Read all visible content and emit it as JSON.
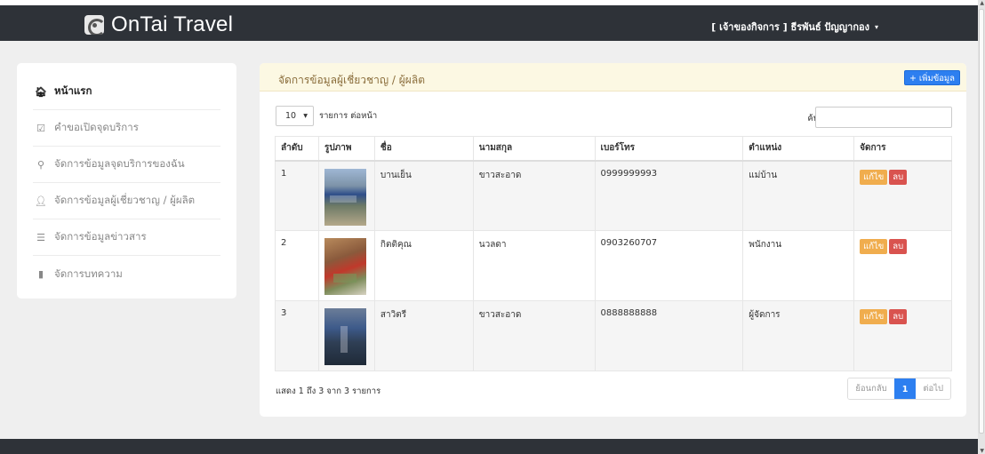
{
  "brand": {
    "name": "OnTai Travel"
  },
  "header": {
    "user": "[ เจ้าของกิจการ ] ธีรพันธ์ ปัญญากอง",
    "caret": "▾"
  },
  "sidebar": {
    "items": [
      {
        "label": "หน้าแรก",
        "icon": "home-icon",
        "glyph": "🏠︎",
        "active": true
      },
      {
        "label": "คำขอเปิดจุดบริการ",
        "icon": "check-square-icon",
        "glyph": "☑"
      },
      {
        "label": "จัดการข้อมูลจุดบริการของฉัน",
        "icon": "map-marker-icon",
        "glyph": "⚲"
      },
      {
        "label": "จัดการข้อมูลผู้เชี่ยวชาญ / ผู้ผลิต",
        "icon": "user-icon",
        "glyph": "👤︎"
      },
      {
        "label": "จัดการข้อมูลข่าวสาร",
        "icon": "list-icon",
        "glyph": "☰"
      },
      {
        "label": "จัดการบทความ",
        "icon": "book-icon",
        "glyph": "▮"
      }
    ]
  },
  "panel": {
    "title": "จัดการข้อมูลผู้เชี่ยวชาญ / ผู้ผลิต",
    "add_label": "+ เพิ่มข้อมูล",
    "page_size": "10",
    "page_size_caret": "▾",
    "per_page_label": "รายการ ต่อหน้า",
    "search_label": "ค้นหา :",
    "search_value": ""
  },
  "table": {
    "headers": [
      "ลำดับ",
      "รูปภาพ",
      "ชื่อ",
      "นามสกุล",
      "เบอร์โทร",
      "ตำแหน่ง",
      "จัดการ"
    ],
    "rows": [
      {
        "no": "1",
        "first": "บานเย็น",
        "last": "ขาวสะอาด",
        "phone": "0999999993",
        "position": "แม่บ้าน"
      },
      {
        "no": "2",
        "first": "กิตติคุณ",
        "last": "นวลดา",
        "phone": "0903260707",
        "position": "พนักงาน"
      },
      {
        "no": "3",
        "first": "สาวิตรี",
        "last": "ขาวสะอาด",
        "phone": "0888888888",
        "position": "ผู้จัดการ"
      }
    ],
    "edit_label": "แก้ไข",
    "delete_label": "ลบ"
  },
  "footer_info": "แสดง 1 ถึง 3 จาก 3 รายการ",
  "pager": {
    "prev": "ย้อนกลับ",
    "current": "1",
    "next": "ต่อไป"
  },
  "colors": {
    "topbar": "#2e3238",
    "primary": "#2d7ff0",
    "warning": "#f0ad4e",
    "danger": "#d9534f",
    "panel_head": "#fcf8e3"
  }
}
